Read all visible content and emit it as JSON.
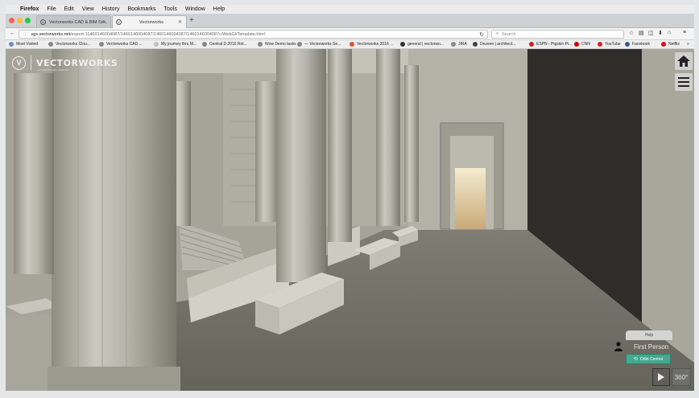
{
  "menubar": {
    "items": [
      "Firefox",
      "File",
      "Edit",
      "View",
      "History",
      "Bookmarks",
      "Tools",
      "Window",
      "Help"
    ]
  },
  "tabs": [
    {
      "label": "Vectorworks CAD & BIM So...",
      "active": false
    },
    {
      "label": "Vectorworks",
      "active": true
    }
  ],
  "navbar": {
    "url_host": "vgx.vectorworks.net",
    "url_path": "/export-11460146004087/1460146004087/1460146004087/1460146004087c/WebGl/Template.html",
    "search_placeholder": "Search"
  },
  "bookmarks": [
    {
      "label": "Most Visited",
      "color": "#6a8fc2"
    },
    {
      "label": "Vectorworks Clou...",
      "color": "#888888"
    },
    {
      "label": "Vectorworks CAD ...",
      "color": "#888888"
    },
    {
      "label": "My journey thru M...",
      "color": "#c0c0c0"
    },
    {
      "label": "Central D 2016 Rol...",
      "color": "#888888"
    },
    {
      "label": "Wow Demo tasks",
      "color": "#888888"
    },
    {
      "label": "— Vectorworks Se...",
      "color": "#888888"
    },
    {
      "label": "Vectorworks 2016 ...",
      "color": "#e0522a"
    },
    {
      "label": "general | vectorwo...",
      "color": "#333333"
    },
    {
      "label": "JIRA",
      "color": "#888888"
    },
    {
      "label": "Dezeen | architect...",
      "color": "#444444"
    },
    {
      "label": "ESPN - Pigskin Pi...",
      "color": "#cc2222"
    },
    {
      "label": "CNN",
      "color": "#cc0000"
    },
    {
      "label": "YouTube",
      "color": "#dd2222"
    },
    {
      "label": "Facebook",
      "color": "#3b5998"
    },
    {
      "label": "Netflix",
      "color": "#e50914"
    }
  ],
  "viewer": {
    "logo_text": "VECTORWORKS",
    "logo_tagline": "A NEMETSCHEK COMPANY",
    "help_label": "Help",
    "mode_label": "First Person",
    "orbit_label": "Orbit Control",
    "deg_label": "360°"
  },
  "colors": {
    "accent_orbit": "#45a890"
  }
}
